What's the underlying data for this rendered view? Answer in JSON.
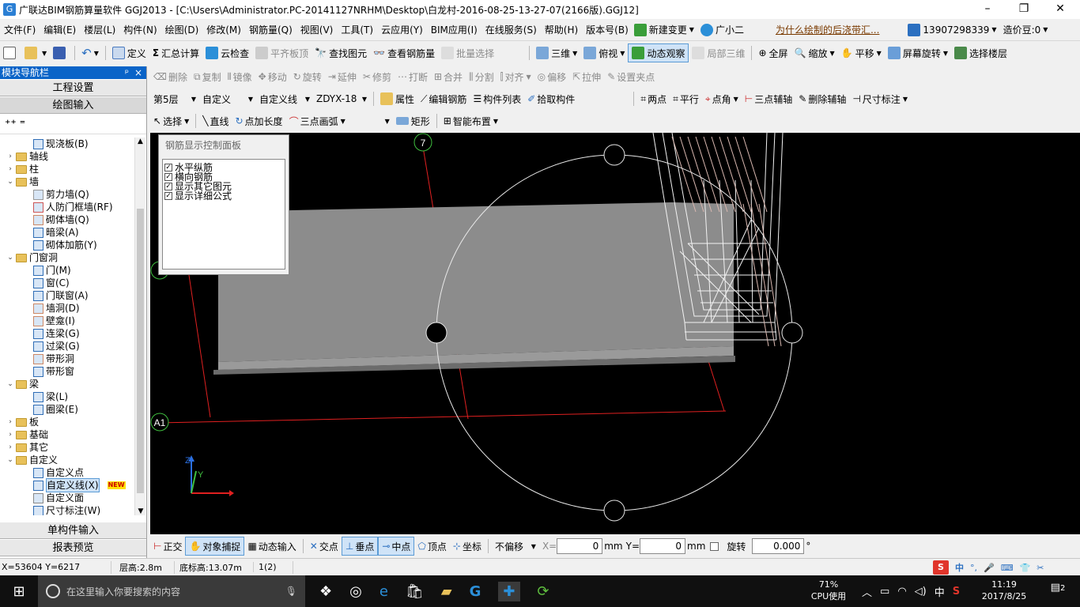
{
  "window": {
    "title": "广联达BIM钢筋算量软件 GGJ2013 - [C:\\Users\\Administrator.PC-20141127NRHM\\Desktop\\白龙村-2016-08-25-13-27-07(2166版).GGJ12]",
    "minimize": "–",
    "maximize": "❐",
    "close": "✕"
  },
  "menu": {
    "items": [
      "文件(F)",
      "编辑(E)",
      "楼层(L)",
      "构件(N)",
      "绘图(D)",
      "修改(M)",
      "钢筋量(Q)",
      "视图(V)",
      "工具(T)",
      "云应用(Y)",
      "BIM应用(I)",
      "在线服务(S)",
      "帮助(H)",
      "版本号(B)"
    ],
    "new_change": "新建变更",
    "assistant": "广小二",
    "link": "为什么绘制的后浇带汇...",
    "phone": "13907298339",
    "price_bean": "造价豆:0"
  },
  "toolbar1": {
    "define": "定义",
    "sum_calc": "汇总计算",
    "cloud_check": "云检查",
    "level_slab": "平齐板顶",
    "find_element": "查找图元",
    "view_rebar": "查看钢筋量",
    "batch_select": "批量选择",
    "three_d": "三维",
    "top_view": "俯视",
    "dynamic_view": "动态观察",
    "local_3d": "局部三维",
    "fullscreen": "全屏",
    "zoom": "缩放",
    "pan": "平移",
    "screen_rotate": "屏幕旋转",
    "select_floor": "选择楼层"
  },
  "toolbar2": {
    "delete": "删除",
    "copy": "复制",
    "mirror": "镜像",
    "move": "移动",
    "rotate": "旋转",
    "extend": "延伸",
    "trim": "修剪",
    "break": "打断",
    "merge": "合并",
    "split": "分割",
    "align": "对齐",
    "offset": "偏移",
    "stretch": "拉伸",
    "set_grip": "设置夹点"
  },
  "toolbar3": {
    "floor": "第5层",
    "category": "自定义",
    "type": "自定义线",
    "element": "ZDYX-18",
    "properties": "属性",
    "edit_rebar": "编辑钢筋",
    "element_list": "构件列表",
    "pick_element": "拾取构件",
    "two_point": "两点",
    "parallel": "平行",
    "point_angle": "点角",
    "three_point_aux": "三点辅轴",
    "delete_aux": "删除辅轴",
    "dimension": "尺寸标注"
  },
  "toolbar4": {
    "select": "选择",
    "line": "直线",
    "point_length": "点加长度",
    "three_point_arc": "三点画弧",
    "rectangle": "矩形",
    "smart_layout": "智能布置"
  },
  "leftpanel": {
    "title": "模块导航栏",
    "pin": "ᵖ",
    "close": "×",
    "project_settings": "工程设置",
    "drawing_input": "绘图输入",
    "single_input": "单构件输入",
    "report_preview": "报表预览",
    "tree": [
      {
        "label": "现浇板(B)",
        "level": 2,
        "kind": "leaf",
        "color": "#2f6db5"
      },
      {
        "label": "轴线",
        "level": 0,
        "kind": "folder",
        "exp": "›"
      },
      {
        "label": "柱",
        "level": 0,
        "kind": "folder",
        "exp": "›"
      },
      {
        "label": "墙",
        "level": 0,
        "kind": "folder",
        "exp": "⌄"
      },
      {
        "label": "剪力墙(Q)",
        "level": 2,
        "kind": "leaf",
        "color": "#999"
      },
      {
        "label": "人防门框墙(RF)",
        "level": 2,
        "kind": "leaf",
        "color": "#c55"
      },
      {
        "label": "砌体墙(Q)",
        "level": 2,
        "kind": "leaf",
        "color": "#c86"
      },
      {
        "label": "暗梁(A)",
        "level": 2,
        "kind": "leaf",
        "color": "#2f6db5"
      },
      {
        "label": "砌体加筋(Y)",
        "level": 2,
        "kind": "leaf",
        "color": "#2f6db5"
      },
      {
        "label": "门窗洞",
        "level": 0,
        "kind": "folder",
        "exp": "⌄"
      },
      {
        "label": "门(M)",
        "level": 2,
        "kind": "leaf",
        "color": "#2f6db5"
      },
      {
        "label": "窗(C)",
        "level": 2,
        "kind": "leaf",
        "color": "#2f6db5"
      },
      {
        "label": "门联窗(A)",
        "level": 2,
        "kind": "leaf",
        "color": "#2f6db5"
      },
      {
        "label": "墙洞(D)",
        "level": 2,
        "kind": "leaf",
        "color": "#c86"
      },
      {
        "label": "壁龛(I)",
        "level": 2,
        "kind": "leaf",
        "color": "#c86"
      },
      {
        "label": "连梁(G)",
        "level": 2,
        "kind": "leaf",
        "color": "#2f6db5"
      },
      {
        "label": "过梁(G)",
        "level": 2,
        "kind": "leaf",
        "color": "#2f6db5"
      },
      {
        "label": "带形洞",
        "level": 2,
        "kind": "leaf",
        "color": "#c86"
      },
      {
        "label": "带形窗",
        "level": 2,
        "kind": "leaf",
        "color": "#2f6db5"
      },
      {
        "label": "梁",
        "level": 0,
        "kind": "folder",
        "exp": "⌄"
      },
      {
        "label": "梁(L)",
        "level": 2,
        "kind": "leaf",
        "color": "#2f6db5"
      },
      {
        "label": "圈梁(E)",
        "level": 2,
        "kind": "leaf",
        "color": "#2f6db5"
      },
      {
        "label": "板",
        "level": 0,
        "kind": "folder",
        "exp": "›"
      },
      {
        "label": "基础",
        "level": 0,
        "kind": "folder",
        "exp": "›"
      },
      {
        "label": "其它",
        "level": 0,
        "kind": "folder",
        "exp": "›"
      },
      {
        "label": "自定义",
        "level": 0,
        "kind": "folder",
        "exp": "⌄"
      },
      {
        "label": "自定义点",
        "level": 2,
        "kind": "leaf",
        "color": "#2f6db5"
      },
      {
        "label": "自定义线(X)",
        "level": 2,
        "kind": "leaf",
        "color": "#2f6db5",
        "selected": true
      },
      {
        "label": "自定义面",
        "level": 2,
        "kind": "leaf",
        "color": "#888"
      },
      {
        "label": "尺寸标注(W)",
        "level": 2,
        "kind": "leaf",
        "color": "#2f6db5"
      }
    ],
    "new_badge": "NEW"
  },
  "rebar_panel": {
    "title": "钢筋显示控制面板",
    "options": [
      "水平纵筋",
      "横向钢筋",
      "显示其它图元",
      "显示详细公式"
    ]
  },
  "canvas": {
    "axis_top": "7",
    "axis_left": "A1",
    "axis_z": "Z",
    "axis_y": "Y"
  },
  "snapbar": {
    "ortho": "正交",
    "object_snap": "对象捕捉",
    "dynamic_input": "动态输入",
    "intersection": "交点",
    "perpendicular": "垂点",
    "midpoint": "中点",
    "vertex": "顶点",
    "coordinate": "坐标",
    "offset_mode": "不偏移",
    "x_label": "X=",
    "x_value": "0",
    "y_label": "Y=",
    "y_value": "0",
    "unit": "mm",
    "rotate": "旋转",
    "rotate_value": "0.000",
    "degree": "°"
  },
  "status": {
    "coords": "X=53604  Y=6217",
    "floor_height": "层高:2.8m",
    "base_height": "底标高:13.07m",
    "count": "1(2)"
  },
  "taskbar": {
    "search_placeholder": "在这里输入你要搜索的内容",
    "cpu_percent": "71%",
    "cpu_label": "CPU使用",
    "ime": "中",
    "time": "11:19",
    "date": "2017/8/25",
    "notifications": "2"
  },
  "ime_bar": {
    "lang": "中"
  }
}
